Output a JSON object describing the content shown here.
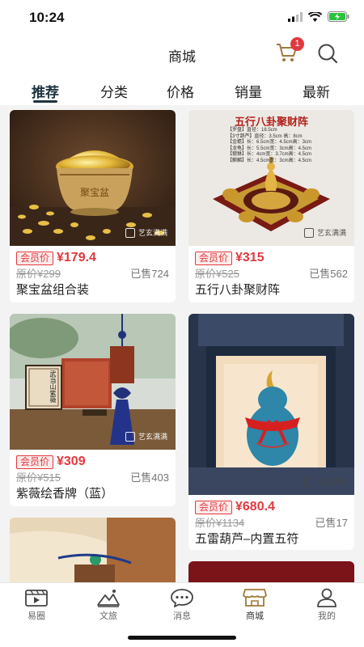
{
  "status_bar": {
    "time": "10:24"
  },
  "header": {
    "title": "商城",
    "cart_count": "1"
  },
  "tabs": [
    {
      "label": "推荐"
    },
    {
      "label": "分类"
    },
    {
      "label": "价格"
    },
    {
      "label": "销量"
    },
    {
      "label": "最新"
    }
  ],
  "member_label": "会员价",
  "products": [
    {
      "name": "聚宝盆组合装",
      "price": "¥179.4",
      "original_price": "原价¥299",
      "sold": "已售724"
    },
    {
      "name": "五行八卦聚财阵",
      "price": "¥315",
      "original_price": "原价¥525",
      "sold": "已售562",
      "image_text": {
        "title": "五行八卦聚财阵",
        "lines": [
          "【罗盘】直径：18.5cm",
          "【3寸葫芦】直径：3.5cm 高：8cm",
          "【金蟾】长：6.5cm宽：4.5cm高：3cm",
          "【龙龟】长：5.5cm宽：3cm高：4.5cm",
          "【貔貅】长：4cm宽：3.7cm高：4.5cm",
          "【麒麟】长：4.5cm宽：3cm高：4.5cm"
        ]
      }
    },
    {
      "name": "紫薇绘香牌（蓝）",
      "price": "¥309",
      "original_price": "原价¥515",
      "sold": "已售403",
      "image_text": {
        "box_label": "武当山紫薇"
      }
    },
    {
      "name": "五雷葫芦–内置五符",
      "price": "¥680.4",
      "original_price": "原价¥1134",
      "sold": "已售17"
    }
  ],
  "watermark": "艺玄满满",
  "bottom_nav": [
    {
      "label": "易圈",
      "icon": "video-icon"
    },
    {
      "label": "文旅",
      "icon": "landscape-icon"
    },
    {
      "label": "消息",
      "icon": "message-icon"
    },
    {
      "label": "商城",
      "icon": "store-icon",
      "active": true
    },
    {
      "label": "我的",
      "icon": "user-icon"
    }
  ],
  "colors": {
    "accent": "#e0393e",
    "tab_active": "#1d3340",
    "nav_active": "#a07a3a"
  }
}
